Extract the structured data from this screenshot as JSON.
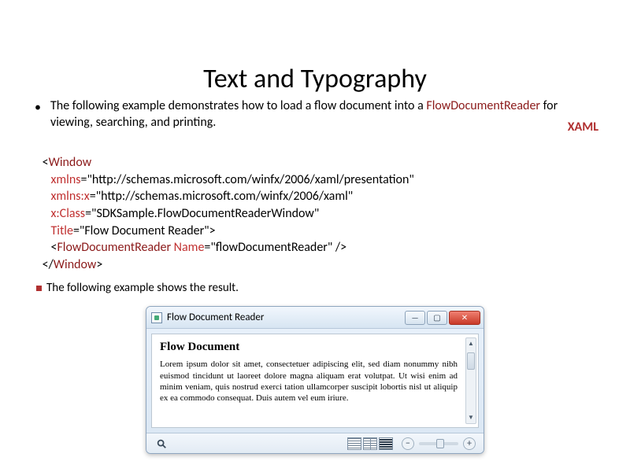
{
  "title": "Text and Typography",
  "bullet1_pre": "The following example demonstrates how to load a flow document into a ",
  "bullet1_kw": "FlowDocumentReader",
  "bullet1_post": " for viewing, searching, and printing.",
  "xaml_label": "XAML",
  "code": {
    "l1a": "<",
    "l1b": "Window",
    "l2a": "xmlns",
    "l2b": "=\"http://schemas.microsoft.com/winfx/2006/xaml/presentation\"",
    "l3a": "xmlns:x",
    "l3b": "=\"http://schemas.microsoft.com/winfx/2006/xaml\"",
    "l4a": "x:Class",
    "l4b": "=\"SDKSample.FlowDocumentReaderWindow\"",
    "l5a": "Title",
    "l5b": "=\"Flow Document Reader\">",
    "l6a": "<",
    "l6b": "FlowDocumentReader",
    "l6c": " Name",
    "l6d": "=\"flowDocumentReader\" />",
    "l7a": "</",
    "l7b": "Window",
    "l7c": ">"
  },
  "result_line": "The following example shows the result.",
  "window": {
    "title": "Flow Document Reader",
    "doc_title": "Flow Document",
    "doc_body": "Lorem ipsum dolor sit amet, consectetuer adipiscing elit, sed diam nonummy nibh euismod tincidunt ut laoreet dolore magna aliquam erat volutpat. Ut wisi enim ad minim veniam, quis nostrud exerci tation ullamcorper suscipit lobortis nisl ut aliquip ex ea commodo consequat. Duis autem vel eum iriure."
  },
  "btn": {
    "min": "—",
    "max": "▢",
    "close": "✕",
    "up": "▲",
    "down": "▼",
    "minus": "−",
    "plus": "+"
  }
}
